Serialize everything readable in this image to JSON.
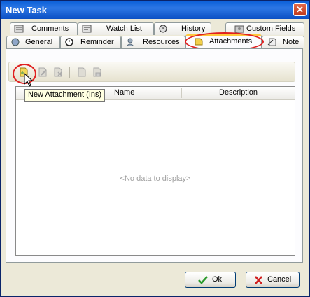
{
  "window": {
    "title": "New Task"
  },
  "tabs_row1": [
    {
      "label": "Comments",
      "icon": "comments-icon"
    },
    {
      "label": "Watch List",
      "icon": "watch-list-icon"
    },
    {
      "label": "History",
      "icon": "history-icon"
    },
    {
      "label": "Custom Fields",
      "icon": "custom-fields-icon"
    }
  ],
  "tabs_row2": [
    {
      "label": "General",
      "icon": "general-icon"
    },
    {
      "label": "Reminder",
      "icon": "reminder-icon"
    },
    {
      "label": "Resources",
      "icon": "resources-icon"
    },
    {
      "label": "Attachments",
      "icon": "attachments-icon",
      "active": true
    },
    {
      "label": "Note",
      "icon": "note-icon"
    }
  ],
  "toolbar": {
    "buttons": [
      {
        "name": "new-attachment",
        "icon": "new-attachment-icon",
        "tooltip": "New Attachment (Ins)"
      },
      {
        "name": "edit-attachment",
        "icon": "edit-attachment-icon"
      },
      {
        "name": "delete-attachment",
        "icon": "delete-attachment-icon"
      },
      {
        "name": "open-attachment",
        "icon": "open-attachment-icon"
      },
      {
        "name": "save-attachment",
        "icon": "save-attachment-icon"
      }
    ]
  },
  "grid": {
    "columns": [
      "Name",
      "Description"
    ],
    "empty_text": "<No data to display>"
  },
  "tooltip": {
    "text": "New Attachment (Ins)"
  },
  "buttons": {
    "ok": "Ok",
    "cancel": "Cancel"
  },
  "colors": {
    "title_bar": "#0a5fd8",
    "highlight_ring": "#e02020",
    "ok_check": "#2a9a2a",
    "cancel_x": "#d02020"
  }
}
